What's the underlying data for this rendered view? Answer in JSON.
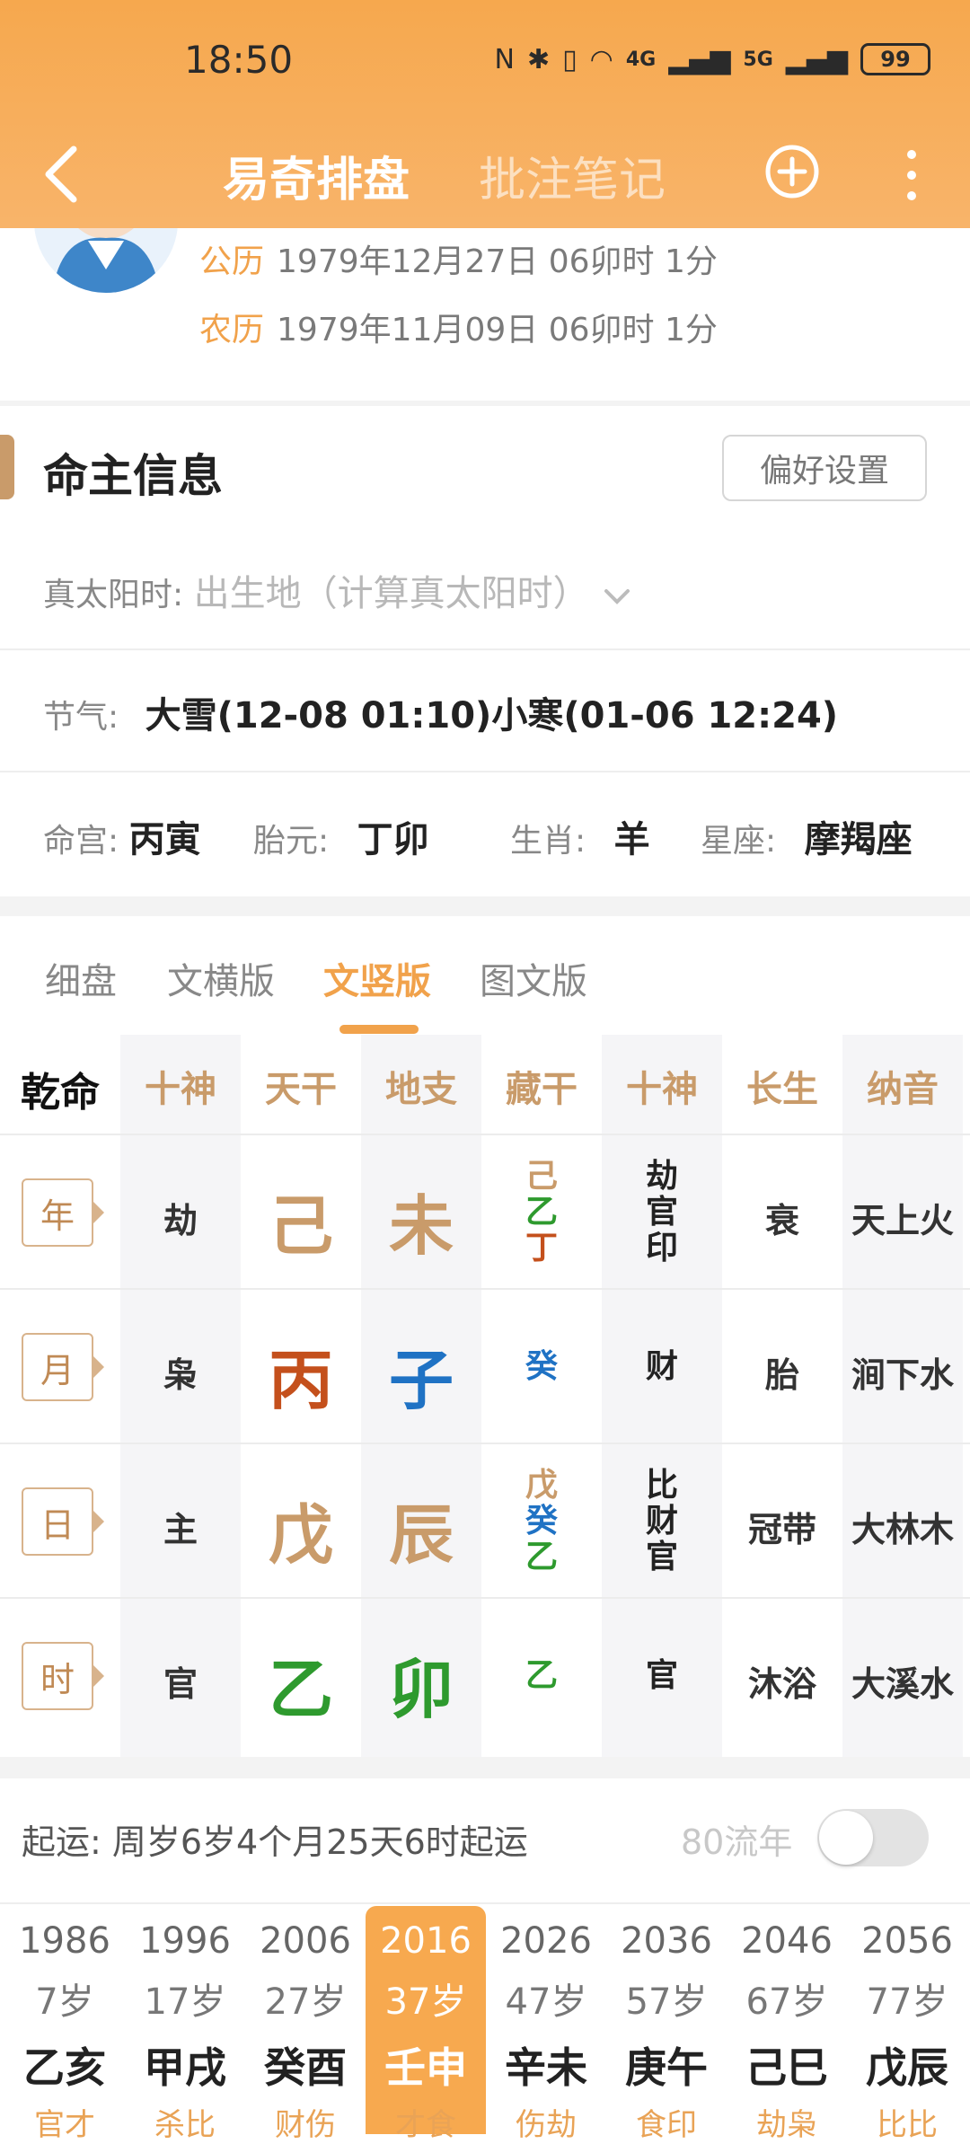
{
  "status": {
    "time": "18:50",
    "battery": "99",
    "signal_a": "4G",
    "signal_b": "5G"
  },
  "nav": {
    "active_title": "易奇排盘",
    "inactive_title": "批注笔记"
  },
  "birth": {
    "solar_key": "公历",
    "solar_value": "1979年12月27日 06卯时 1分",
    "lunar_key": "农历",
    "lunar_value": "1979年11月09日 06卯时 1分"
  },
  "owner": {
    "title": "命主信息",
    "pref_button": "偏好设置",
    "true_solar_key": "真太阳时:",
    "true_solar_placeholder": "出生地（计算真太阳时）",
    "solar_term_key": "节气:",
    "solar_term_value": "大雪(12-08 01:10)小寒(01-06 12:24)",
    "ming_gong_key": "命宫:",
    "ming_gong_value": "丙寅",
    "tai_yuan_key": "胎元:",
    "tai_yuan_value": "丁卯",
    "zodiac_key": "生肖:",
    "zodiac_value": "羊",
    "constellation_key": "星座:",
    "constellation_value": "摩羯座"
  },
  "tabs": [
    "细盘",
    "文横版",
    "文竖版",
    "图文版"
  ],
  "chart": {
    "corner": "乾命",
    "headers": [
      "十神",
      "天干",
      "地支",
      "藏干",
      "十神",
      "长生",
      "纳音"
    ],
    "rows": [
      {
        "label": "年",
        "shishen": "劫",
        "tiangan": "己",
        "dizhi": "未",
        "canggan": [
          "己",
          "乙",
          "丁"
        ],
        "canggan_shishen": [
          "劫",
          "官",
          "印"
        ],
        "changsheng": "衰",
        "nayin": "天上火"
      },
      {
        "label": "月",
        "shishen": "枭",
        "tiangan": "丙",
        "dizhi": "子",
        "canggan": [
          "癸"
        ],
        "canggan_shishen": [
          "财"
        ],
        "changsheng": "胎",
        "nayin": "涧下水"
      },
      {
        "label": "日",
        "shishen": "主",
        "tiangan": "戊",
        "dizhi": "辰",
        "canggan": [
          "戊",
          "癸",
          "乙"
        ],
        "canggan_shishen": [
          "比",
          "财",
          "官"
        ],
        "changsheng": "冠带",
        "nayin": "大林木"
      },
      {
        "label": "时",
        "shishen": "官",
        "tiangan": "乙",
        "dizhi": "卯",
        "canggan": [
          "乙"
        ],
        "canggan_shishen": [
          "官"
        ],
        "changsheng": "沐浴",
        "nayin": "大溪水"
      }
    ]
  },
  "colors": {
    "earth": "#c99b6a",
    "fire": "#c4501c",
    "water": "#1f72c4",
    "wood": "#2e9a2e",
    "accent": "#f1a24b"
  },
  "luck": {
    "start_text": "起运:  周岁6岁4个月25天6时起运",
    "flow_label": "80流年",
    "decades": [
      {
        "year": "1986",
        "age": "7岁",
        "ganzhi": "乙亥",
        "shishen": "官才"
      },
      {
        "year": "1996",
        "age": "17岁",
        "ganzhi": "甲戌",
        "shishen": "杀比"
      },
      {
        "year": "2006",
        "age": "27岁",
        "ganzhi": "癸酉",
        "shishen": "财伤"
      },
      {
        "year": "2016",
        "age": "37岁",
        "ganzhi": "壬申",
        "shishen": "才食"
      },
      {
        "year": "2026",
        "age": "47岁",
        "ganzhi": "辛未",
        "shishen": "伤劫"
      },
      {
        "year": "2036",
        "age": "57岁",
        "ganzhi": "庚午",
        "shishen": "食印"
      },
      {
        "year": "2046",
        "age": "67岁",
        "ganzhi": "己巳",
        "shishen": "劫枭"
      },
      {
        "year": "2056",
        "age": "77岁",
        "ganzhi": "戊辰",
        "shishen": "比比"
      }
    ]
  }
}
